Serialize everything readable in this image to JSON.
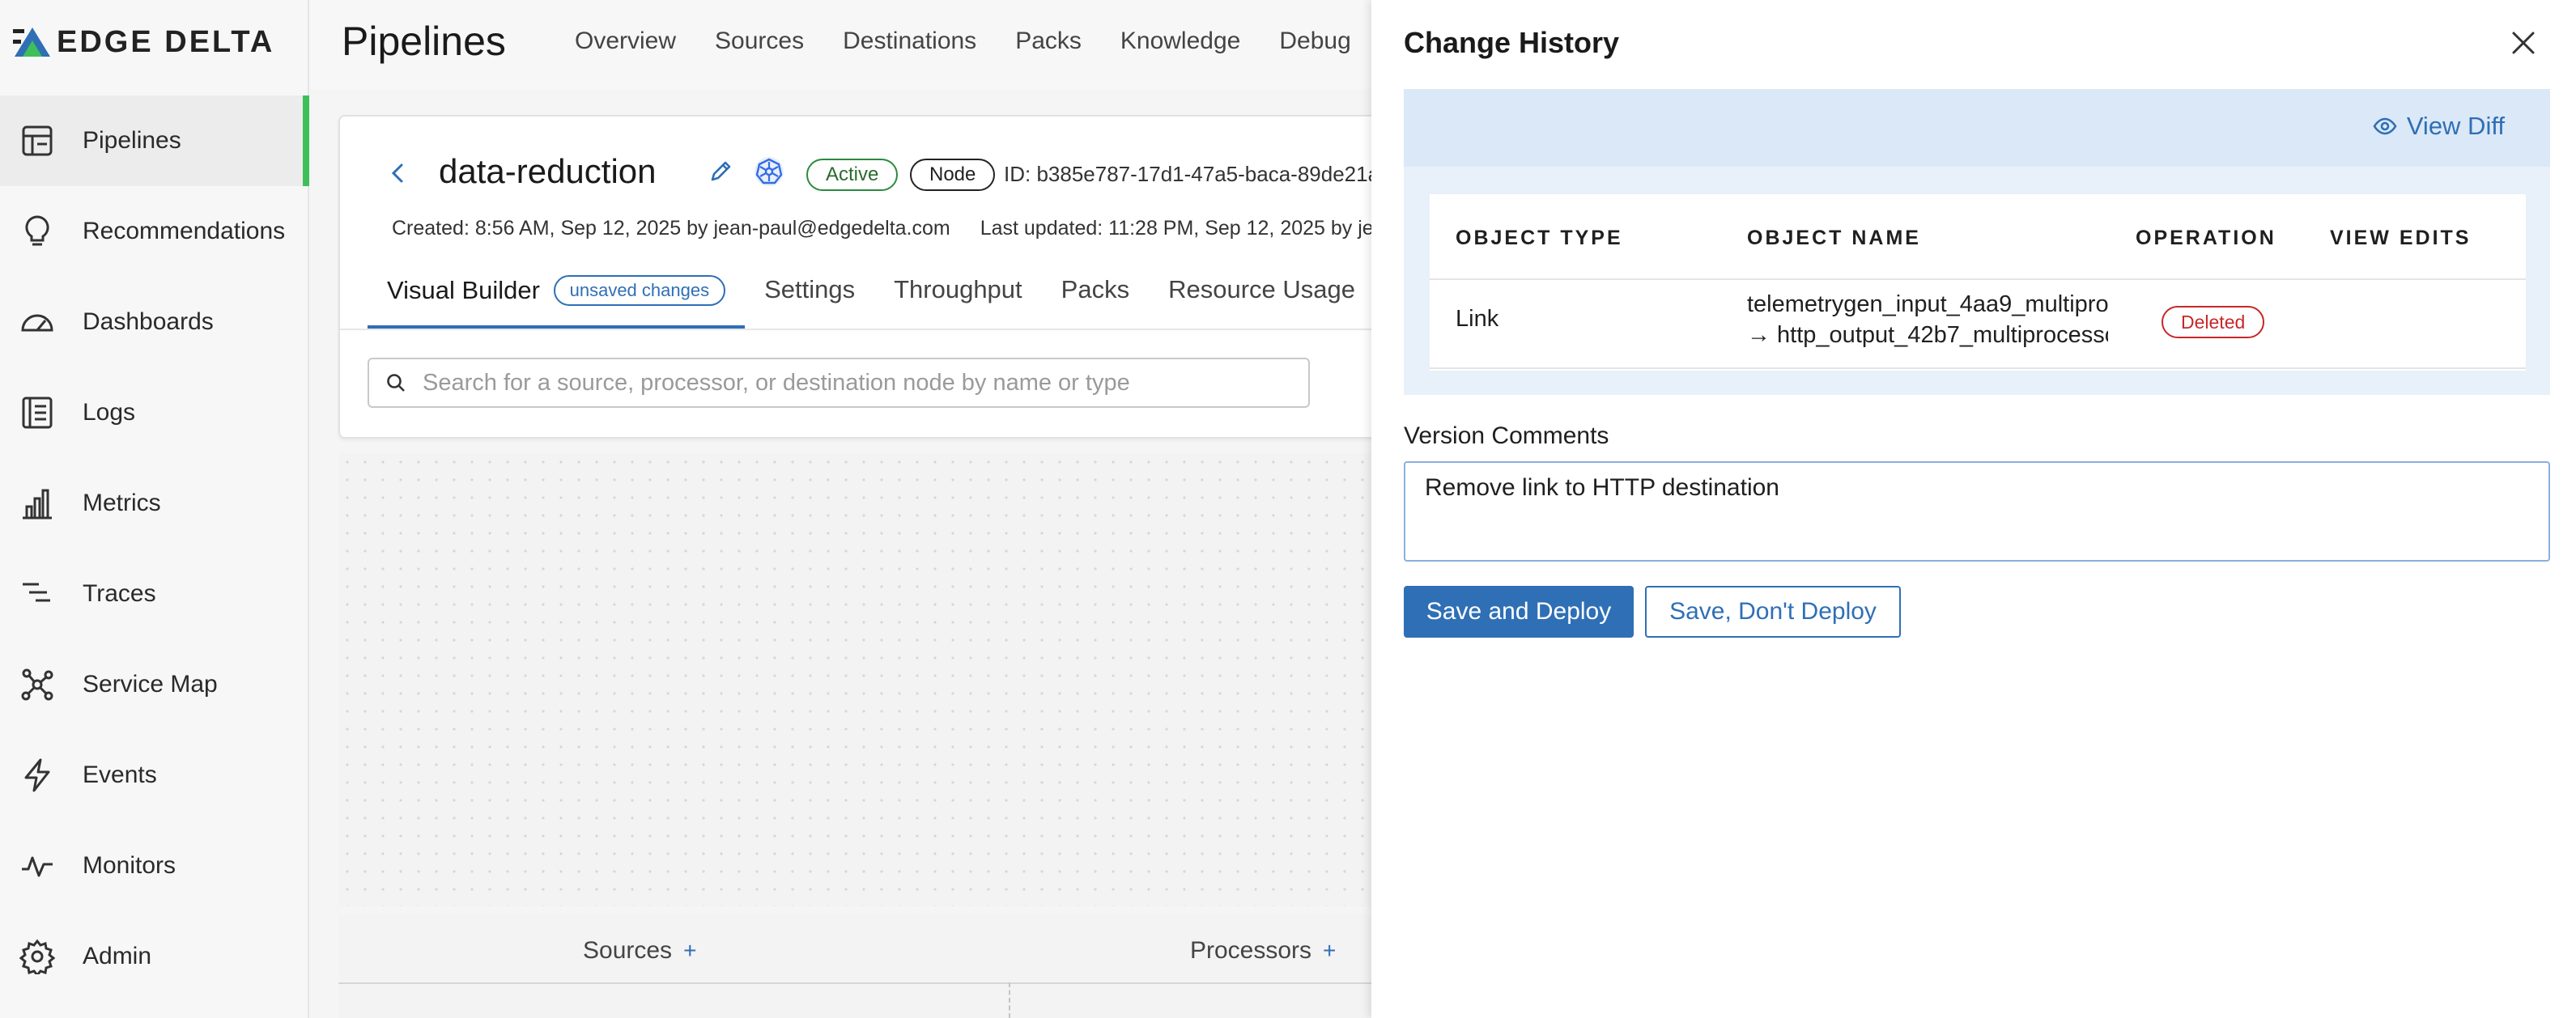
{
  "brand": {
    "logo_text": "EDGE DELTA",
    "accent": "#2f6fb5",
    "active_green": "#3fbf5a"
  },
  "sidebar": {
    "items": [
      {
        "label": "Pipelines",
        "icon": "pipelines-icon",
        "active": true
      },
      {
        "label": "Recommendations",
        "icon": "lightbulb-icon"
      },
      {
        "label": "Dashboards",
        "icon": "gauge-icon"
      },
      {
        "label": "Logs",
        "icon": "logs-icon"
      },
      {
        "label": "Metrics",
        "icon": "bar-chart-icon"
      },
      {
        "label": "Traces",
        "icon": "traces-icon"
      },
      {
        "label": "Service Map",
        "icon": "service-map-icon"
      },
      {
        "label": "Events",
        "icon": "lightning-icon"
      },
      {
        "label": "Monitors",
        "icon": "pulse-icon"
      },
      {
        "label": "Admin",
        "icon": "gear-icon"
      }
    ]
  },
  "header": {
    "title": "Pipelines",
    "tabs": [
      "Overview",
      "Sources",
      "Destinations",
      "Packs",
      "Knowledge",
      "Debug"
    ]
  },
  "pipeline": {
    "name": "data-reduction",
    "status_badge": "Active",
    "type_badge": "Node",
    "id_text": "ID: b385e787-17d1-47a5-baca-89de21a",
    "created": "Created: 8:56 AM, Sep 12, 2025 by jean-paul@edgedelta.com",
    "updated": "Last updated: 11:28 PM, Sep 12, 2025 by je",
    "tabs": {
      "visual_builder": "Visual Builder",
      "unsaved": "unsaved changes",
      "settings": "Settings",
      "throughput": "Throughput",
      "packs": "Packs",
      "resource_usage": "Resource Usage"
    },
    "search_placeholder": "Search for a source, processor, or destination node by name or type",
    "columns": {
      "sources": "Sources",
      "processors": "Processors",
      "plus": "+"
    }
  },
  "drawer": {
    "title": "Change History",
    "view_diff": "View Diff",
    "table": {
      "headers": [
        "OBJECT TYPE",
        "OBJECT NAME",
        "OPERATION",
        "VIEW EDITS"
      ],
      "rows": [
        {
          "object_type": "Link",
          "object_name_line1": "telemetrygen_input_4aa9_multipro",
          "object_name_line2": "→ http_output_42b7_multiprocesso",
          "operation": "Deleted"
        }
      ]
    },
    "version_comments_label": "Version Comments",
    "version_comments_value": "Remove link to HTTP destination",
    "save_deploy": "Save and Deploy",
    "save_no_deploy": "Save, Don't Deploy"
  }
}
